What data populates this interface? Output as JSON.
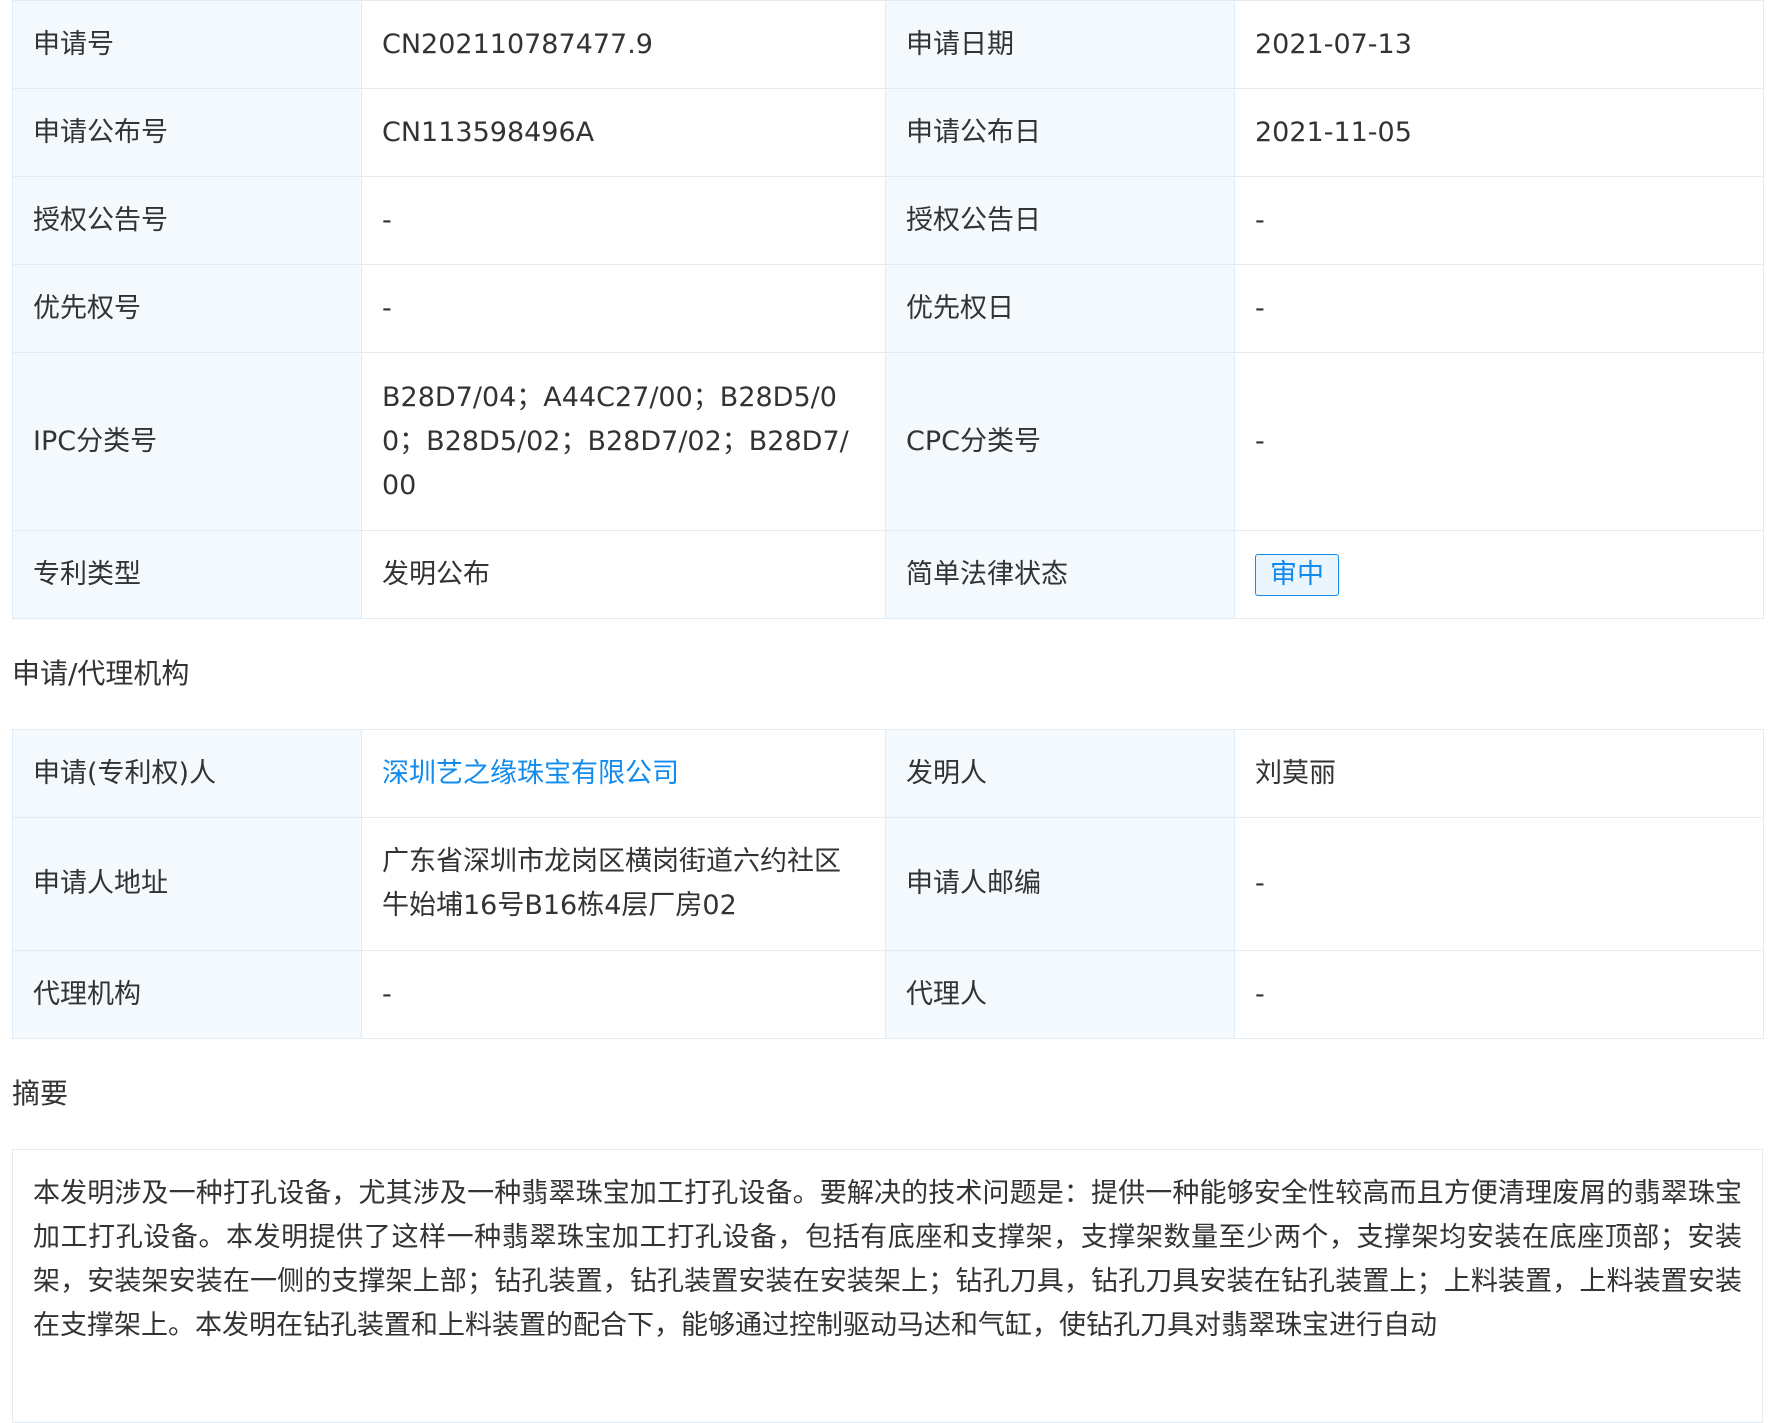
{
  "basic_info": [
    {
      "l1": "申请号",
      "v1": "CN202110787477.9",
      "l2": "申请日期",
      "v2": "2021-07-13"
    },
    {
      "l1": "申请公布号",
      "v1": "CN113598496A",
      "l2": "申请公布日",
      "v2": "2021-11-05"
    },
    {
      "l1": "授权公告号",
      "v1": "-",
      "l2": "授权公告日",
      "v2": "-"
    },
    {
      "l1": "优先权号",
      "v1": "-",
      "l2": "优先权日",
      "v2": "-"
    },
    {
      "l1": "IPC分类号",
      "v1": "B28D7/04；A44C27/00；B28D5/00；B28D5/02；B28D7/02；B28D7/00",
      "l2": "CPC分类号",
      "v2": "-"
    },
    {
      "l1": "专利类型",
      "v1": "发明公布",
      "l2": "简单法律状态",
      "v2": "审中"
    }
  ],
  "applicant_section_title": "申请/代理机构",
  "applicant_info": [
    {
      "l1": "申请(专利权)人",
      "v1": "深圳艺之缘珠宝有限公司",
      "l2": "发明人",
      "v2": "刘莫丽"
    },
    {
      "l1": "申请人地址",
      "v1": "广东省深圳市龙岗区横岗街道六约社区牛始埔16号B16栋4层厂房02",
      "l2": "申请人邮编",
      "v2": "-"
    },
    {
      "l1": "代理机构",
      "v1": "-",
      "l2": "代理人",
      "v2": "-"
    }
  ],
  "abstract_title": "摘要",
  "abstract_text": "本发明涉及一种打孔设备，尤其涉及一种翡翠珠宝加工打孔设备。要解决的技术问题是：提供一种能够安全性较高而且方便清理废屑的翡翠珠宝加工打孔设备。本发明提供了这样一种翡翠珠宝加工打孔设备，包括有底座和支撑架，支撑架数量至少两个，支撑架均安装在底座顶部；安装架，安装架安装在一侧的支撑架上部；钻孔装置，钻孔装置安装在安装架上；钻孔刀具，钻孔刀具安装在钻孔装置上；上料装置，上料装置安装在支撑架上。本发明在钻孔装置和上料装置的配合下，能够通过控制驱动马达和气缸，使钻孔刀具对翡翠珠宝进行自动",
  "colors": {
    "label_bg": "#f3f9fd",
    "border": "#e4ecf3",
    "link": "#128bed"
  }
}
